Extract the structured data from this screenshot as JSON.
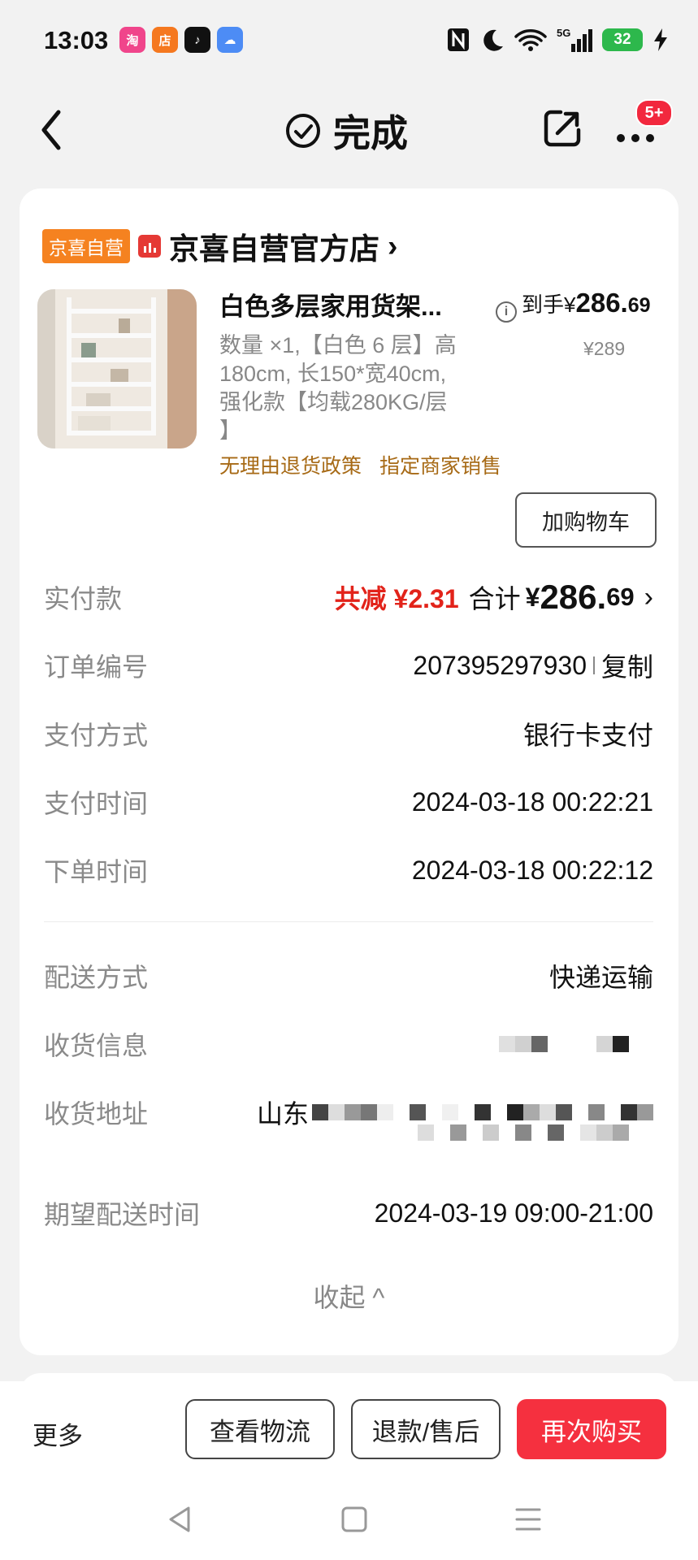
{
  "status_bar": {
    "time": "13:03",
    "app_icons": [
      {
        "name": "taobao-app-icon",
        "glyph": "淘",
        "color": "#f0458b"
      },
      {
        "name": "shop-app-icon",
        "glyph": "店",
        "color": "#f5781f"
      },
      {
        "name": "tiktok-app-icon",
        "glyph": "♪",
        "color": "#111111"
      },
      {
        "name": "cloud-app-icon",
        "glyph": "☁",
        "color": "#4d8cf5"
      }
    ],
    "network": "5G",
    "battery": "32"
  },
  "header": {
    "title": "完成",
    "badge": "5+"
  },
  "store": {
    "tag": "京喜自营",
    "name": "京喜自营官方店",
    "chevron": "›"
  },
  "product": {
    "title": "白色多层家用货架...",
    "price_label": "到手",
    "price_symbol": "¥",
    "price_int": "286.",
    "price_dec": "69",
    "original_price": "¥289",
    "spec": "数量 ×1,【白色 6 层】高180cm, 长150*宽40cm,强化款【均载280KG/层 】",
    "tags": [
      "无理由退货政策",
      "指定商家销售"
    ],
    "add_cart": "加购物车"
  },
  "details": {
    "paid": {
      "label": "实付款",
      "discount": "共减 ¥2.31",
      "total_label": "合计",
      "total_symbol": "¥",
      "total_int": "286.",
      "total_dec": "69",
      "chevron": "›"
    },
    "order_no": {
      "label": "订单编号",
      "value": "207395297930",
      "copy": "复制"
    },
    "pay_method": {
      "label": "支付方式",
      "value": "银行卡支付"
    },
    "pay_time": {
      "label": "支付时间",
      "value": "2024-03-18 00:22:21"
    },
    "order_time": {
      "label": "下单时间",
      "value": "2024-03-18 00:22:12"
    },
    "delivery": {
      "label": "配送方式",
      "value": "快递运输"
    },
    "receiver": {
      "label": "收货信息"
    },
    "address": {
      "label": "收货地址",
      "value_prefix": "山东"
    },
    "expected": {
      "label": "期望配送时间",
      "value": "2024-03-19 09:00-21:00"
    },
    "collapse": "收起 ^"
  },
  "bottom_bar": {
    "more": "更多",
    "logistics": "查看物流",
    "refund": "退款/售后",
    "buy_again": "再次购买"
  },
  "colors": {
    "accent_red": "#f5303f",
    "discount_red": "#e2231a",
    "store_tag_orange": "#f58220",
    "tag_brown": "#a76a16"
  }
}
